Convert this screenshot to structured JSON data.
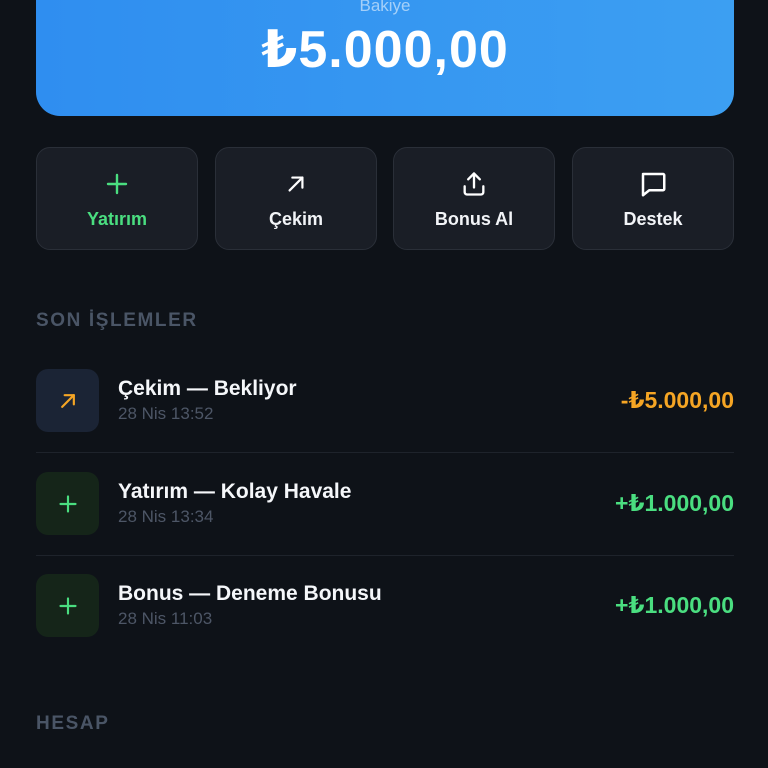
{
  "balance": {
    "label": "Bakiye",
    "amount": "₺5.000,00"
  },
  "actions": [
    {
      "label": "Yatırım",
      "icon": "plus-icon"
    },
    {
      "label": "Çekim",
      "icon": "arrow-up-right-icon"
    },
    {
      "label": "Bonus Al",
      "icon": "share-upload-icon"
    },
    {
      "label": "Destek",
      "icon": "chat-bubble-icon"
    }
  ],
  "recent": {
    "title": "SON İŞLEMLER",
    "items": [
      {
        "title": "Çekim — Bekliyor",
        "time": "28 Nis 13:52",
        "amount": "-₺5.000,00",
        "icon": "arrow-up-right-icon"
      },
      {
        "title": "Yatırım — Kolay Havale",
        "time": "28 Nis 13:34",
        "amount": "+₺1.000,00",
        "icon": "plus-icon"
      },
      {
        "title": "Bonus — Deneme Bonusu",
        "time": "28 Nis 11:03",
        "amount": "+₺1.000,00",
        "icon": "plus-icon"
      }
    ]
  },
  "account": {
    "title": "HESAP"
  },
  "colors": {
    "background": "#0e1218",
    "accent": "#3b9bf1",
    "positive": "#4ade80",
    "pending": "#f5a524",
    "muted": "#4a5566"
  }
}
